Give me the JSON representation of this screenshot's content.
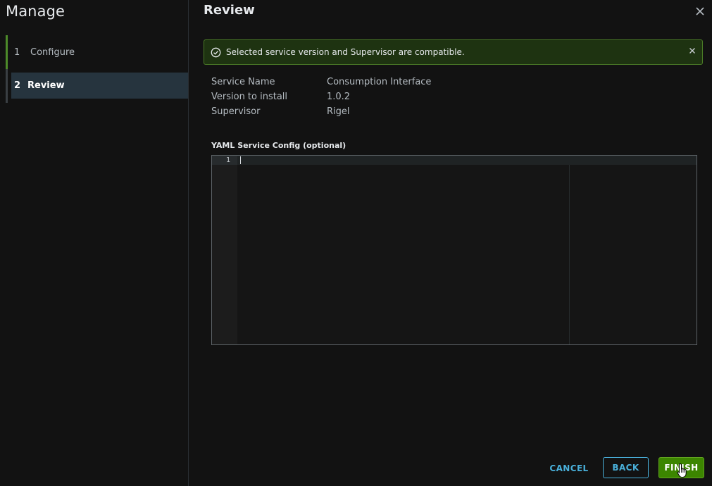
{
  "sidebar": {
    "title": "Manage",
    "steps": [
      {
        "number": "1",
        "label": "Configure"
      },
      {
        "number": "2",
        "label": "Review"
      }
    ]
  },
  "main": {
    "title": "Review",
    "alert": {
      "text": "Selected service version and Supervisor are compatible.",
      "status_color": "#4a7a26"
    },
    "info": [
      {
        "label": "Service Name",
        "value": "Consumption Interface"
      },
      {
        "label": "Version to install",
        "value": "1.0.2"
      },
      {
        "label": "Supervisor",
        "value": "Rigel"
      }
    ],
    "yaml": {
      "label": "YAML Service Config (optional)",
      "line_numbers": [
        "1"
      ],
      "content": ""
    }
  },
  "footer": {
    "cancel_label": "CANCEL",
    "back_label": "BACK",
    "finish_label": "FINISH"
  },
  "colors": {
    "background": "#121212",
    "accent": "#49afd9",
    "primary_button": "#3c8500",
    "active_step_bg": "#26343e"
  },
  "icons": {
    "close": "close-icon",
    "alert": "check-circle-icon",
    "alert_close": "close-icon",
    "cursor": "hand-pointer-icon"
  }
}
